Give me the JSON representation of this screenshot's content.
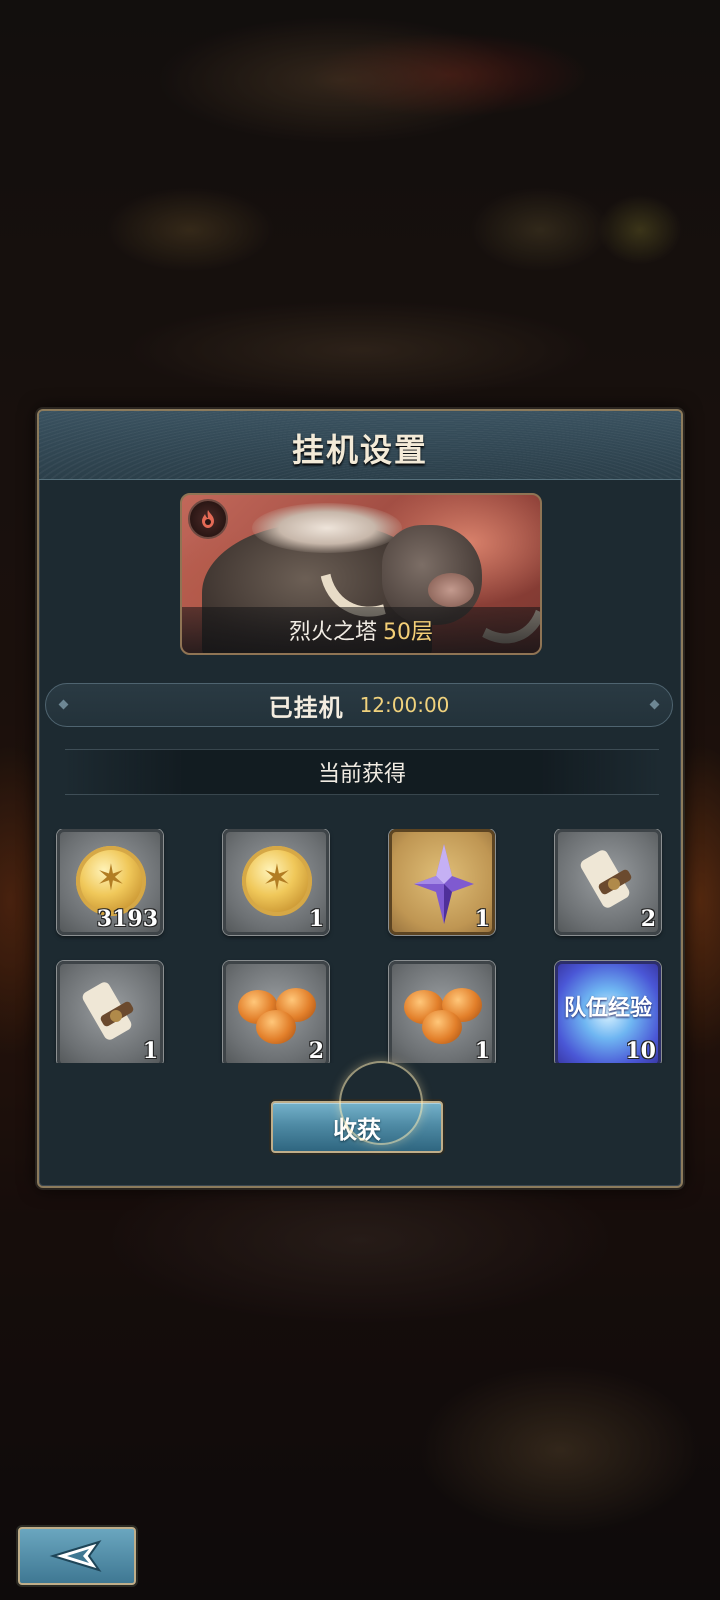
{
  "dialog": {
    "title": "挂机设置",
    "stage": {
      "name": "烈火之塔",
      "floor": "50层",
      "element_icon": "fire-element-icon"
    },
    "idle": {
      "label": "已挂机",
      "time": "12:00:00"
    },
    "acquired_label": "当前获得",
    "rewards": [
      {
        "icon": "gold-coin-icon",
        "count": "3193"
      },
      {
        "icon": "gold-coin-icon",
        "count": "1"
      },
      {
        "icon": "purple-crystal-icon",
        "count": "1"
      },
      {
        "icon": "scroll-icon",
        "count": "2"
      },
      {
        "icon": "scroll-icon",
        "count": "1"
      },
      {
        "icon": "bread-buns-icon",
        "count": "2"
      },
      {
        "icon": "bread-buns-icon",
        "count": "1"
      },
      {
        "icon": "team-exp-icon",
        "label": "队伍经验",
        "count": "10"
      }
    ],
    "collect_label": "收获"
  },
  "navigation": {
    "back_icon": "back-arrow-icon"
  },
  "colors": {
    "accent_gold": "#f0d27d",
    "button_blue": "#4f8ba5",
    "panel_bg": "#1d2a31"
  }
}
